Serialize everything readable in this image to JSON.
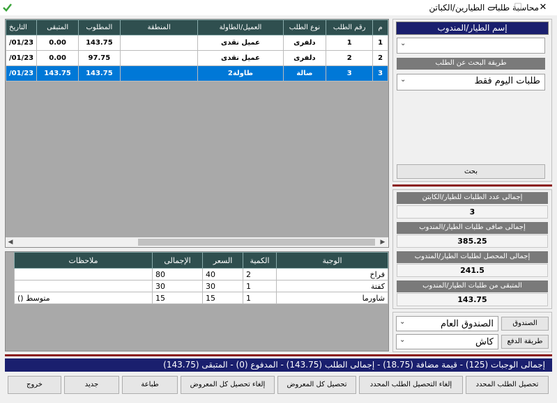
{
  "window": {
    "title": "محاسبة طلبات الطيارين/الكباتن",
    "minimize_glyph": "—",
    "maximize_glyph": "☐",
    "close_glyph": "✕"
  },
  "orders_grid": {
    "columns": [
      "م",
      "رقم الطلب",
      "نوع الطلب",
      "العميل/الطاولة",
      "المنطقة",
      "المطلوب",
      "المتبقى",
      "التاريخ"
    ],
    "rows": [
      {
        "idx": "1",
        "order_no": "1",
        "type": "دلفرى",
        "client": "عميل نقدى",
        "area": "",
        "required": "143.75",
        "remaining": "0.00",
        "date": "01/23/"
      },
      {
        "idx": "2",
        "order_no": "2",
        "type": "دلفرى",
        "client": "عميل نقدى",
        "area": "",
        "required": "97.75",
        "remaining": "0.00",
        "date": "01/23/"
      },
      {
        "idx": "3",
        "order_no": "3",
        "type": "صالة",
        "client": "طاولة2",
        "area": "",
        "required": "143.75",
        "remaining": "143.75",
        "date": "01/23/"
      }
    ],
    "selected_row": 2
  },
  "items_grid": {
    "columns": [
      "الوجبة",
      "الكمية",
      "السعر",
      "الإجمالى",
      "ملاحظات"
    ],
    "rows": [
      {
        "meal": "فراخ",
        "qty": "2",
        "price": "40",
        "total": "80",
        "notes": ""
      },
      {
        "meal": "كفتة",
        "qty": "1",
        "price": "30",
        "total": "30",
        "notes": ""
      },
      {
        "meal": "شاورما",
        "qty": "1",
        "price": "15",
        "total": "15",
        "notes": "متوسط ()"
      }
    ]
  },
  "sidebar": {
    "driver_label": "إسم الطيار/المندوب",
    "driver_value": "",
    "search_method_label": "طريقة البحث عن الطلب",
    "search_method_value": "طلبات اليوم فقط",
    "search_button": "بحث",
    "stats": [
      {
        "label": "إجمالى عدد الطلبات للطيار/الكابتن",
        "value": "3"
      },
      {
        "label": "إجمالى صافى طلبات الطيار/المندوب",
        "value": "385.25"
      },
      {
        "label": "إجمالى المحصل لطلبات الطيار/المندوب",
        "value": "241.5"
      },
      {
        "label": "المتبقى من طلبات الطيار/المندوب",
        "value": "143.75"
      }
    ],
    "cashbox_label": "الصندوق",
    "cashbox_value": "الصندوق العام",
    "payment_method_label": "طريقة الدفع",
    "payment_method_value": "كاش"
  },
  "summary_bar": "إجمالى الوجبات (125) - قيمة مضافة (18.75) - إجمالى الطلب (143.75) - المدفوع (0) - المتبقى (143.75)",
  "buttons": {
    "collect_selected": "تحصيل الطلب المحدد",
    "cancel_collect_selected": "إلغاء التحصيل الطلب المحدد",
    "collect_all": "تحصيل كل المعروض",
    "cancel_collect_all": "إلغاء تحصيل كل المعروض",
    "print": "طباعة",
    "new": "جديد",
    "exit": "خروج"
  },
  "colors": {
    "navy": "#1a1f6e",
    "header_teal": "#2f4f4f",
    "selection_blue": "#0078d7",
    "divider_red": "#8b1a1a"
  }
}
